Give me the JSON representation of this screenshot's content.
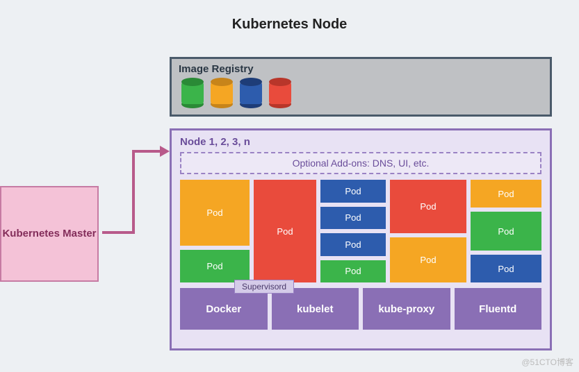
{
  "title": "Kubernetes Node",
  "master": "Kubernetes Master",
  "registry": {
    "label": "Image Registry",
    "cylinders": [
      {
        "fill": "#3bb44a",
        "shade": "#2a8a36"
      },
      {
        "fill": "#f5a623",
        "shade": "#c7841a"
      },
      {
        "fill": "#2d5cad",
        "shade": "#1e3d78"
      },
      {
        "fill": "#e94b3c",
        "shade": "#b8362a"
      }
    ]
  },
  "node": {
    "label": "Node 1, 2, 3, n",
    "addons": "Optional Add-ons: DNS, UI, etc.",
    "supervisord": "Supervisord",
    "services": [
      "Docker",
      "kubelet",
      "kube-proxy",
      "Fluentd"
    ]
  },
  "pod_label": "Pod",
  "colors": {
    "orange": "#f5a623",
    "green": "#3bb44a",
    "red": "#e94b3c",
    "blue": "#2d5cad",
    "purple": "#8a6fb5",
    "purple_light": "#e8e2f4",
    "pink": "#f4c2d7"
  },
  "watermark": "@51CTO博客",
  "chart_data": {
    "type": "diagram",
    "components": [
      {
        "name": "Kubernetes Master",
        "connects_to": [
          "Node"
        ]
      },
      {
        "name": "Image Registry",
        "contains": [
          "image-green",
          "image-orange",
          "image-blue",
          "image-red"
        ]
      },
      {
        "name": "Node",
        "label": "Node 1, 2, 3, n",
        "contains": [
          "Optional Add-ons: DNS, UI, etc.",
          "Pods",
          "Supervisord",
          "Docker",
          "kubelet",
          "kube-proxy",
          "Fluentd"
        ]
      },
      {
        "name": "Pods",
        "instances": [
          {
            "color": "orange"
          },
          {
            "color": "green"
          },
          {
            "color": "red"
          },
          {
            "color": "blue"
          },
          {
            "color": "blue"
          },
          {
            "color": "blue"
          },
          {
            "color": "green"
          },
          {
            "color": "red"
          },
          {
            "color": "orange"
          },
          {
            "color": "orange"
          },
          {
            "color": "green"
          },
          {
            "color": "blue"
          }
        ]
      }
    ]
  }
}
